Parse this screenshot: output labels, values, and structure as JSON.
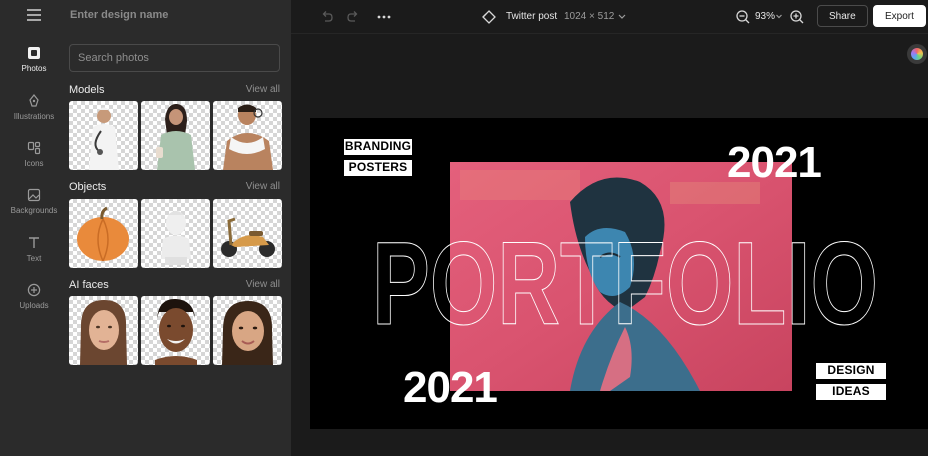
{
  "sidebar": {
    "items": [
      {
        "label": "Photos",
        "icon": "photo-icon"
      },
      {
        "label": "Illustrations",
        "icon": "illustration-icon"
      },
      {
        "label": "Icons",
        "icon": "icons-icon"
      },
      {
        "label": "Backgrounds",
        "icon": "background-icon"
      },
      {
        "label": "Text",
        "icon": "text-icon"
      },
      {
        "label": "Uploads",
        "icon": "upload-icon"
      }
    ]
  },
  "panel": {
    "design_name_placeholder": "Enter design name",
    "search_placeholder": "Search photos",
    "sections": [
      {
        "title": "Models",
        "view_all": "View all"
      },
      {
        "title": "Objects",
        "view_all": "View all"
      },
      {
        "title": "AI faces",
        "view_all": "View all"
      }
    ]
  },
  "topbar": {
    "doc_title": "Twitter post",
    "doc_size": "1024 × 512",
    "zoom": "93%",
    "share_label": "Share",
    "export_label": "Export"
  },
  "canvas": {
    "label_top_1": "BRANDING",
    "label_top_2": "POSTERS",
    "year_top": "2021",
    "title": "PORTFOLIO",
    "year_bottom": "2021",
    "label_bottom_1": "DESIGN",
    "label_bottom_2": "IDEAS",
    "background": "#000000",
    "photo_tint": "#d9536f"
  }
}
